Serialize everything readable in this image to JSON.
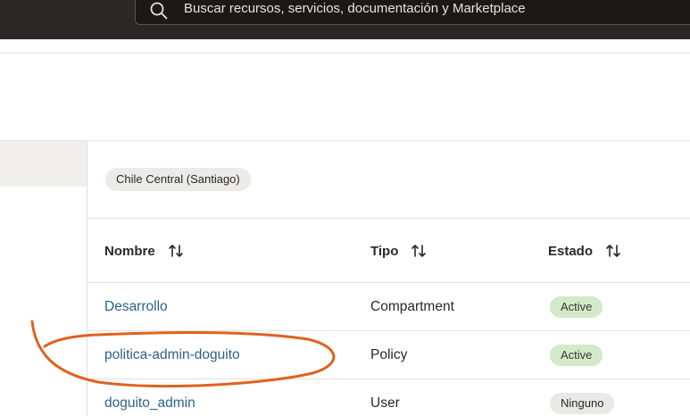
{
  "search": {
    "placeholder": "Buscar recursos, servicios, documentación y Marketplace"
  },
  "region_chip": "Chile Central (Santiago)",
  "table": {
    "columns": [
      "Nombre",
      "Tipo",
      "Estado"
    ],
    "rows": [
      {
        "name": "Desarrollo",
        "type": "Compartment",
        "status": "Active"
      },
      {
        "name": "politica-admin-doguito",
        "type": "Policy",
        "status": "Active"
      },
      {
        "name": "doguito_admin",
        "type": "User",
        "status": "Ninguno"
      }
    ]
  },
  "colors": {
    "topbar": "#2b2724",
    "link": "#2b6389",
    "badge_active": "#d4e9c8",
    "badge_none": "#ebe9e6",
    "annotation": "#e0621f"
  },
  "icons": [
    "search-icon",
    "sort-icon"
  ]
}
